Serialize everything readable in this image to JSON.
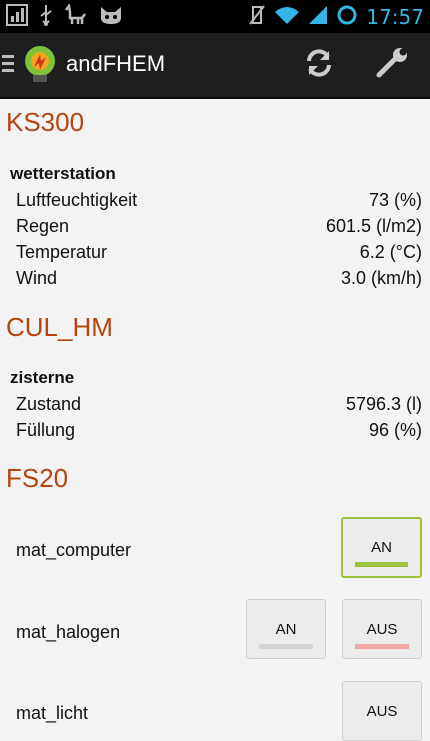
{
  "statusbar": {
    "time": "17:57"
  },
  "app": {
    "title": "andFHEM"
  },
  "colors": {
    "on": "#9dc33d",
    "off": "#f4a7a7",
    "neutral": "#d4d4d4",
    "room": "#b5440f"
  },
  "rooms": [
    {
      "name": "KS300",
      "device": "wetterstation",
      "readings": [
        {
          "label": "Luftfeuchtigkeit",
          "value": "73 (%)"
        },
        {
          "label": "Regen",
          "value": "601.5 (l/m2)"
        },
        {
          "label": "Temperatur",
          "value": "6.2 (°C)"
        },
        {
          "label": "Wind",
          "value": "3.0 (km/h)"
        }
      ]
    },
    {
      "name": "CUL_HM",
      "device": "zisterne",
      "readings": [
        {
          "label": "Zustand",
          "value": "5796.3 (l)"
        },
        {
          "label": "Füllung",
          "value": "96 (%)"
        }
      ]
    },
    {
      "name": "FS20",
      "switches": [
        {
          "name": "mat_computer",
          "buttons": [
            "AN"
          ]
        },
        {
          "name": "mat_halogen",
          "buttons": [
            "AN",
            "AUS"
          ]
        },
        {
          "name": "mat_licht",
          "buttons": [
            "AUS"
          ]
        }
      ]
    }
  ]
}
